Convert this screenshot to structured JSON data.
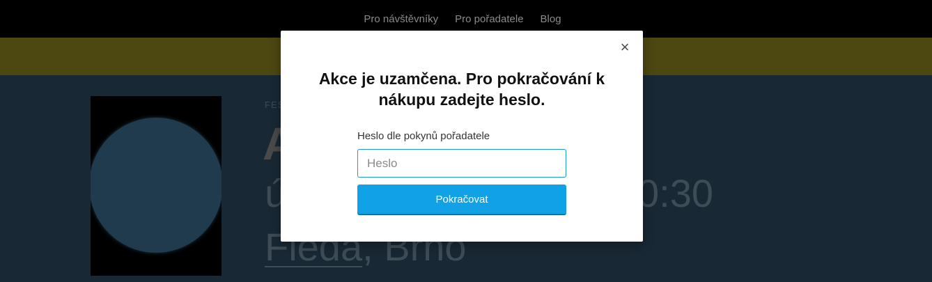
{
  "nav": {
    "items": [
      "Pro návštěvníky",
      "Pro pořadatele",
      "Blog"
    ]
  },
  "event": {
    "category": "FES",
    "title": "A",
    "date": "ú",
    "time": "0:30",
    "venue": "Fleda",
    "city": ", Brno"
  },
  "modal": {
    "close_icon": "×",
    "title": "Akce je uzamčena. Pro pokračování k nákupu zadejte heslo.",
    "field_label": "Heslo dle pokynů pořadatele",
    "input_placeholder": "Heslo",
    "input_value": "",
    "submit_label": "Pokračovat"
  },
  "colors": {
    "accent": "#10a1e6",
    "banner": "#4d4711",
    "hero_bg": "#182834"
  }
}
